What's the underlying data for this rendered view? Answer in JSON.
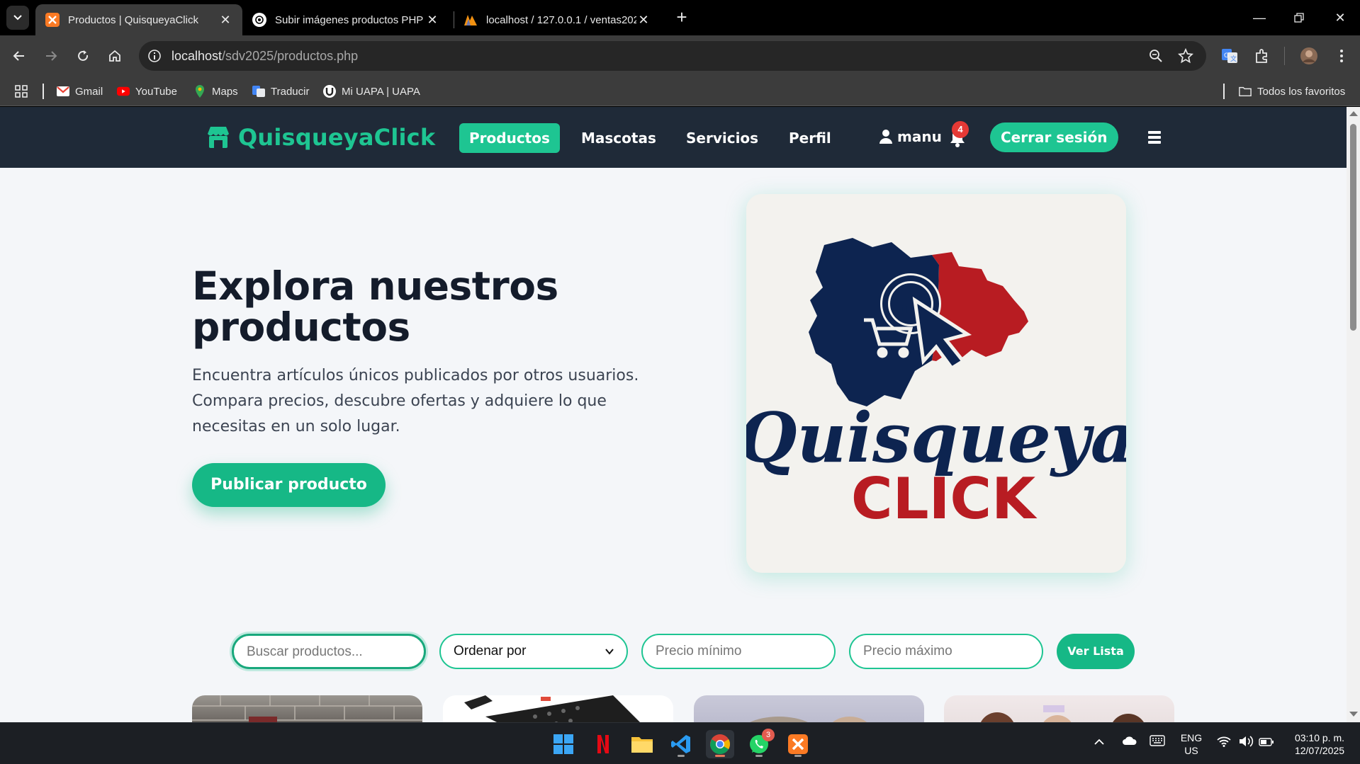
{
  "browser": {
    "tabs": [
      {
        "title": "Productos | QuisqueyaClick",
        "active": true,
        "favicon": "xampp-icon"
      },
      {
        "title": "Subir imágenes productos PHP",
        "active": false,
        "favicon": "chatgpt-icon"
      },
      {
        "title": "localhost / 127.0.0.1 / ventas2025",
        "active": false,
        "favicon": "phpmyadmin-icon"
      }
    ],
    "url_host": "localhost",
    "url_path": "/sdv2025/productos.php",
    "bookmarks": [
      {
        "label": "Gmail",
        "icon": "gmail-icon"
      },
      {
        "label": "YouTube",
        "icon": "youtube-icon"
      },
      {
        "label": "Maps",
        "icon": "maps-icon"
      },
      {
        "label": "Traducir",
        "icon": "translate-icon"
      },
      {
        "label": "Mi UAPA | UAPA",
        "icon": "uapa-icon"
      }
    ],
    "all_bookmarks_label": "Todos los favoritos"
  },
  "site": {
    "brand": "QuisqueyaClick",
    "nav": [
      {
        "label": "Productos",
        "active": true
      },
      {
        "label": "Mascotas",
        "active": false
      },
      {
        "label": "Servicios",
        "active": false
      },
      {
        "label": "Perfil",
        "active": false
      }
    ],
    "user": "manu",
    "notifications": "4",
    "logout": "Cerrar sesión",
    "accent": "#1ec592"
  },
  "hero": {
    "title": "Explora nuestros productos",
    "text": "Encuentra artículos únicos publicados por otros usuarios. Compara precios, descubre ofertas y adquiere lo que necesitas en un solo lugar.",
    "cta": "Publicar producto",
    "logo_script": "Quisqueya",
    "logo_bold": "CLICK"
  },
  "filters": {
    "search_placeholder": "Buscar productos...",
    "order_label": "Ordenar por",
    "min_placeholder": "Precio mínimo",
    "max_placeholder": "Precio máximo",
    "list_button": "Ver Lista"
  },
  "taskbar": {
    "whatsapp_badge": "3",
    "lang": "ENG",
    "region": "US",
    "time": "03:10 p. m.",
    "date": "12/07/2025"
  }
}
